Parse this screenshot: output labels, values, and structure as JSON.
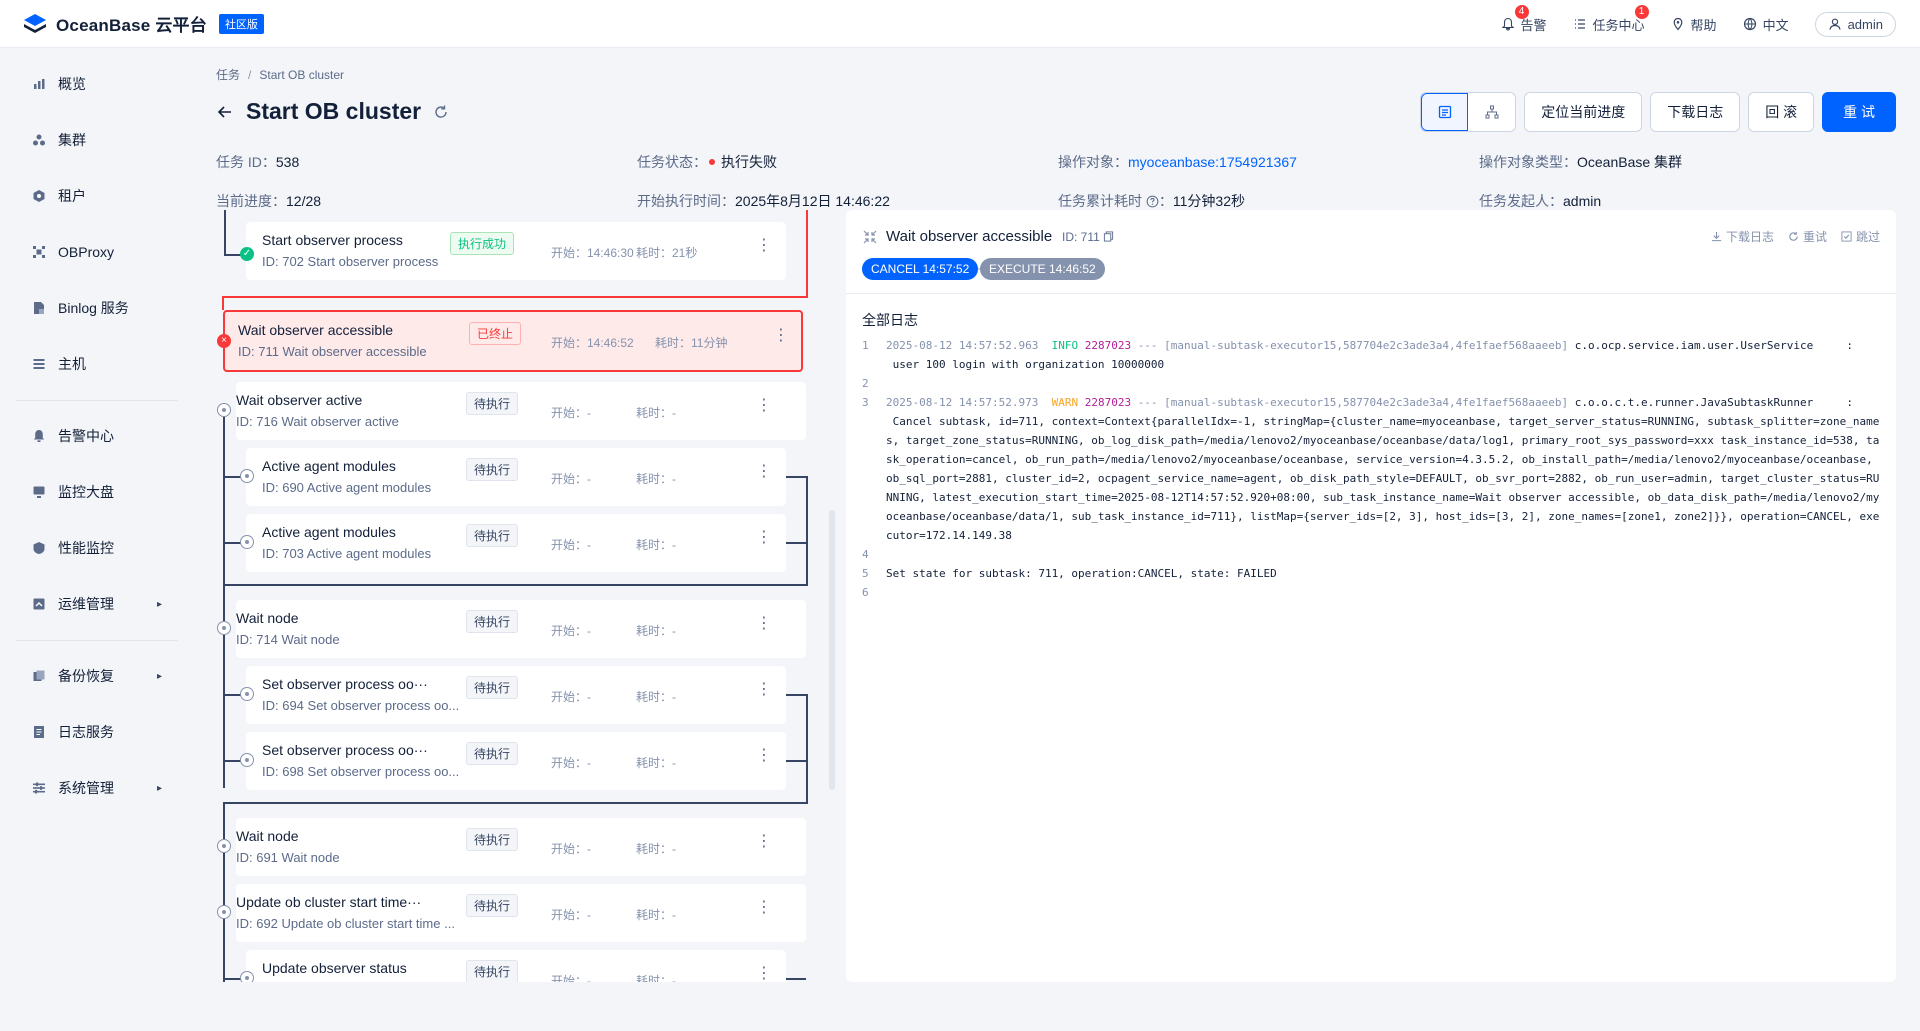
{
  "header": {
    "brand": "OceanBase 云平台",
    "edition": "社区版",
    "alerts": {
      "label": "告警",
      "count": "4"
    },
    "task_center": {
      "label": "任务中心",
      "count": "1"
    },
    "help": "帮助",
    "language": "中文",
    "user": "admin"
  },
  "sidebar": {
    "items": [
      {
        "label": "概览"
      },
      {
        "label": "集群"
      },
      {
        "label": "租户"
      },
      {
        "label": "OBProxy"
      },
      {
        "label": "Binlog 服务"
      },
      {
        "label": "主机"
      },
      {
        "label": "告警中心"
      },
      {
        "label": "监控大盘"
      },
      {
        "label": "性能监控"
      },
      {
        "label": "运维管理",
        "arrow": "▸"
      },
      {
        "label": "备份恢复",
        "arrow": "▸"
      },
      {
        "label": "日志服务"
      },
      {
        "label": "系统管理",
        "arrow": "▸"
      }
    ]
  },
  "breadcrumb": {
    "root": "任务",
    "sep": "/",
    "current": "Start OB cluster"
  },
  "page": {
    "title": "Start OB cluster"
  },
  "actions": {
    "locate": "定位当前进度",
    "download": "下载日志",
    "rollback": "回 滚",
    "retry": "重 试"
  },
  "meta": {
    "task_id_label": "任务 ID：",
    "task_id": "538",
    "status_label": "任务状态：",
    "status": "执行失败",
    "target_label": "操作对象：",
    "target": "myoceanbase:1754921367",
    "target_type_label": "操作对象类型：",
    "target_type": "OceanBase 集群",
    "progress_label": "当前进度：",
    "progress": "12/28",
    "start_label": "开始执行时间：",
    "start": "2025年8月12日 14:46:22",
    "elapsed_label": "任务累计耗时",
    "elapsed": "11分钟32秒",
    "initiator_label": "任务发起人：",
    "initiator": "admin"
  },
  "tasks": [
    {
      "name": "Start observer process",
      "id": "ID: 702  Start observer process",
      "badge": "执行成功",
      "start": "开始：14:46:30",
      "cost": "耗时：21秒"
    },
    {
      "name": "Wait observer accessible",
      "id": "ID: 711  Wait observer accessible",
      "badge": "已终止",
      "start": "开始：14:46:52",
      "cost": "耗时：11分钟"
    },
    {
      "name": "Wait observer active",
      "id": "ID: 716  Wait observer active",
      "badge": "待执行",
      "start": "开始：-",
      "cost": "耗时：-"
    },
    {
      "name": "Active agent modules",
      "id": "ID: 690  Active agent modules",
      "badge": "待执行",
      "start": "开始：-",
      "cost": "耗时：-"
    },
    {
      "name": "Active agent modules",
      "id": "ID: 703  Active agent modules",
      "badge": "待执行",
      "start": "开始：-",
      "cost": "耗时：-"
    },
    {
      "name": "Wait node",
      "id": "ID: 714  Wait node",
      "badge": "待执行",
      "start": "开始：-",
      "cost": "耗时：-"
    },
    {
      "name": "Set observer process oo···",
      "id": "ID: 694  Set observer process oo...",
      "badge": "待执行",
      "start": "开始：-",
      "cost": "耗时：-"
    },
    {
      "name": "Set observer process oo···",
      "id": "ID: 698  Set observer process oo...",
      "badge": "待执行",
      "start": "开始：-",
      "cost": "耗时：-"
    },
    {
      "name": "Wait node",
      "id": "ID: 691  Wait node",
      "badge": "待执行",
      "start": "开始：-",
      "cost": "耗时：-"
    },
    {
      "name": "Update ob cluster start time···",
      "id": "ID: 692  Update ob cluster start time ...",
      "badge": "待执行",
      "start": "开始：-",
      "cost": "耗时：-"
    },
    {
      "name": "Update observer status",
      "id": "",
      "badge": "待执行",
      "start": "开始：-",
      "cost": "耗时：-"
    }
  ],
  "detail": {
    "title": "Wait observer accessible",
    "id": "ID: 711",
    "tools": {
      "download": "下载日志",
      "retry": "重试",
      "skip": "跳过"
    },
    "pills": {
      "cancel": "CANCEL 14:57:52",
      "execute": "EXECUTE 14:46:52"
    },
    "log_title": "全部日志",
    "log_lines": [
      {
        "no": "1",
        "ts": "2025-08-12 14:57:52.963",
        "level": "INFO",
        "pid": "2287023",
        "thread": "--- [manual-subtask-executor15,587704e2c3ade3a4,4fe1faef568aaeeb]",
        "logger": "c.o.ocp.service.iam.user.UserService",
        "msg": "     :\n user 100 login with organization 10000000"
      },
      {
        "no": "2",
        "ts": "",
        "level": "",
        "pid": "",
        "thread": "",
        "logger": "",
        "msg": ""
      },
      {
        "no": "3",
        "ts": "2025-08-12 14:57:52.973",
        "level": "WARN",
        "pid": "2287023",
        "thread": "--- [manual-subtask-executor15,587704e2c3ade3a4,4fe1faef568aaeeb]",
        "logger": "c.o.o.c.t.e.runner.JavaSubtaskRunner",
        "msg": "     :\n Cancel subtask, id=711, context=Context{parallelIdx=-1, stringMap={cluster_name=myoceanbase, target_server_status=RUNNING, subtask_splitter=zone_names, target_zone_status=RUNNING, ob_log_disk_path=/media/lenovo2/myoceanbase/oceanbase/data/log1, primary_root_sys_password=xxx task_instance_id=538, task_operation=cancel, ob_run_path=/media/lenovo2/myoceanbase/oceanbase, service_version=4.3.5.2, ob_install_path=/media/lenovo2/myoceanbase/oceanbase, ob_sql_port=2881, cluster_id=2, ocpagent_service_name=agent, ob_disk_path_style=DEFAULT, ob_svr_port=2882, ob_run_user=admin, target_cluster_status=RUNNING, latest_execution_start_time=2025-08-12T14:57:52.920+08:00, sub_task_instance_name=Wait observer accessible, ob_data_disk_path=/media/lenovo2/myoceanbase/oceanbase/data/1, sub_task_instance_id=711}, listMap={server_ids=[2, 3], host_ids=[3, 2], zone_names=[zone1, zone2]}}, operation=CANCEL, executor=172.14.149.38"
      },
      {
        "no": "4",
        "ts": "",
        "level": "",
        "pid": "",
        "thread": "",
        "logger": "",
        "msg": ""
      },
      {
        "no": "5",
        "ts": "",
        "level": "",
        "pid": "",
        "thread": "",
        "logger": "",
        "msg": "Set state for subtask: 711, operation:CANCEL, state: FAILED"
      },
      {
        "no": "6",
        "ts": "",
        "level": "",
        "pid": "",
        "thread": "",
        "logger": "",
        "msg": ""
      }
    ]
  },
  "colors": {
    "primary": "#0063ff",
    "danger": "#f93939",
    "success": "#0ac185"
  }
}
